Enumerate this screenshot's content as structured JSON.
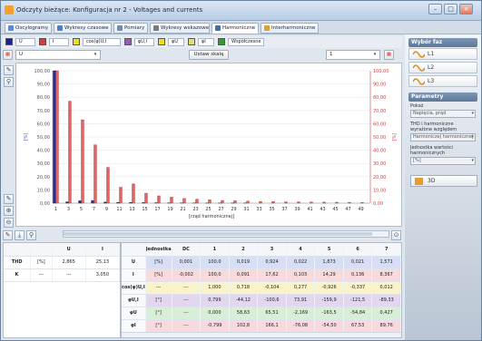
{
  "window": {
    "title": "Odczyty bieżące: Konfiguracja nr 2 - Voltages and currents",
    "controls": [
      "–",
      "□",
      "×"
    ]
  },
  "tabs": [
    {
      "label": "Oscylogramy",
      "color": "#5a8bd6"
    },
    {
      "label": "Wykresy czasowe",
      "color": "#4d7fc4"
    },
    {
      "label": "Pomiary",
      "color": "#6e8fb0"
    },
    {
      "label": "Wykresy wskazowe",
      "color": "#7a7a7a"
    },
    {
      "label": "Harmoniczne",
      "color": "#3f6ea8",
      "active": true
    },
    {
      "label": "Interharmoniczne",
      "color": "#e0a030"
    }
  ],
  "legend": {
    "items": [
      {
        "label": "U",
        "color": "#1f1f9e"
      },
      {
        "label": "I",
        "color": "#d63a3a"
      },
      {
        "label": "cos(φ)U,I",
        "color": "#e8e020"
      },
      {
        "label": "φU,I",
        "color": "#9b59b6"
      },
      {
        "label": "φU",
        "color": "#e8e020"
      },
      {
        "label": "φI",
        "color": "#e0e070"
      },
      {
        "label": "Współczesne",
        "color": "#2ca02c"
      }
    ]
  },
  "controls": {
    "left_select": "U",
    "button": "Ustaw skalę",
    "right_select": "1"
  },
  "chart_data": {
    "type": "bar",
    "xlabel": "[rząd harmonicznej]",
    "ylabel_left": "[%]",
    "ylabel_right": "[%]",
    "ylim": [
      0,
      100
    ],
    "yticks": [
      "0,00",
      "10,00",
      "20,00",
      "30,00",
      "40,00",
      "50,00",
      "60,00",
      "70,00",
      "80,00",
      "90,00",
      "100,00"
    ],
    "xticks": [
      "1",
      "3",
      "5",
      "7",
      "9",
      "11",
      "13",
      "15",
      "17",
      "19",
      "21",
      "23",
      "25",
      "27",
      "29",
      "31",
      "33",
      "35",
      "37",
      "39",
      "41",
      "43",
      "45",
      "47",
      "49"
    ],
    "series": [
      {
        "name": "U",
        "color": "#2d2b8f",
        "values": [
          100.0,
          0.0,
          1.0,
          0.0,
          1.8,
          0.0,
          2.0,
          0.0,
          0.8,
          0.0,
          0.6,
          0.0,
          0.5,
          0.0,
          0.4,
          0.0,
          0.3,
          0.0,
          0.2,
          0.0,
          0.2,
          0.0,
          0.1,
          0.0,
          0.1,
          0.0,
          0.1,
          0.0,
          0.1,
          0.0,
          0.1,
          0.0,
          0.0,
          0.0,
          0.0,
          0.0,
          0.0,
          0.0,
          0.0,
          0.0,
          0.0,
          0.0,
          0.0,
          0.0,
          0.0,
          0.0,
          0.0,
          0.0,
          0.0,
          0.0
        ]
      },
      {
        "name": "I",
        "color": "#e06666",
        "values": [
          100.0,
          0.0,
          77.0,
          0.0,
          63.0,
          0.0,
          44.0,
          0.0,
          27.0,
          0.0,
          12.0,
          0.0,
          14.5,
          0.0,
          7.5,
          0.0,
          5.5,
          0.0,
          4.5,
          0.0,
          3.5,
          0.0,
          3.0,
          0.0,
          2.5,
          0.0,
          2.0,
          0.0,
          1.8,
          0.0,
          1.5,
          0.0,
          1.3,
          0.0,
          1.2,
          0.0,
          1.0,
          0.0,
          1.0,
          0.0,
          0.9,
          0.0,
          0.8,
          0.0,
          0.7,
          0.0,
          0.6,
          0.0,
          0.5,
          0.0
        ]
      }
    ],
    "legend": "none",
    "grid": true
  },
  "table_left": {
    "headers": [
      "",
      "",
      "U",
      "I"
    ],
    "rows": [
      [
        "THD",
        "[%]",
        "2,865",
        "25,13"
      ],
      [
        "K",
        "---",
        "---",
        "3,050"
      ]
    ]
  },
  "table_right": {
    "headers": [
      "",
      "Jednostka",
      "DC",
      "1",
      "2",
      "3",
      "4",
      "5",
      "6",
      "7"
    ],
    "rows": [
      {
        "label": "U",
        "unit": "[%]",
        "values": [
          "0,001",
          "100,0",
          "0,019",
          "0,924",
          "0,022",
          "1,873",
          "0,021",
          "1,571"
        ],
        "tone": "blue"
      },
      {
        "label": "I",
        "unit": "[%]",
        "values": [
          "-0,002",
          "100,0",
          "0,091",
          "17,62",
          "0,103",
          "14,29",
          "0,136",
          "8,367"
        ],
        "tone": "pink"
      },
      {
        "label": "cos(φ)U,I",
        "unit": "---",
        "values": [
          "---",
          "1,000",
          "0,718",
          "-0,104",
          "0,277",
          "-0,926",
          "-0,337",
          "0,012"
        ],
        "tone": "yellow"
      },
      {
        "label": "φU,I",
        "unit": "[°]",
        "values": [
          "---",
          "0,799",
          "-44,12",
          "-100,6",
          "73,91",
          "-159,9",
          "-121,5",
          "-89,33"
        ],
        "tone": "purple"
      },
      {
        "label": "φU",
        "unit": "[°]",
        "values": [
          "---",
          "0,000",
          "58,63",
          "65,51",
          "-2,169",
          "-163,5",
          "-54,84",
          "0,427"
        ],
        "tone": "green"
      },
      {
        "label": "φI",
        "unit": "[°]",
        "values": [
          "---",
          "-0,799",
          "102,8",
          "166,1",
          "-76,08",
          "-54,50",
          "67,53",
          "89,76"
        ],
        "tone": "pink"
      }
    ]
  },
  "sidebar": {
    "phase_header": "Wybór faz",
    "phases": [
      "L1",
      "L2",
      "L3"
    ],
    "params_header": "Parametry",
    "fields": [
      {
        "label": "Pokaż",
        "value": "Napięcia, prąd"
      },
      {
        "label": "THD i harmoniczne wyrażone względem",
        "value": "Harmoniczej harmonicznej"
      },
      {
        "label": "Jednostka wartości harmonicznych",
        "value": "[%]"
      }
    ],
    "button_3d": "3D"
  }
}
